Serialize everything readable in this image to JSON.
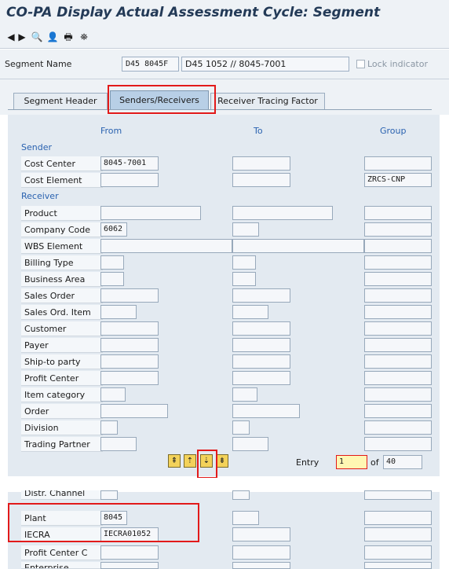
{
  "window": {
    "title": "CO-PA Display Actual Assessment Cycle: Segment"
  },
  "toolbar": {
    "back": "◀",
    "forward": "▶",
    "find": "🔍",
    "user": "👤",
    "print": "🖶",
    "tree": "⛯"
  },
  "segment": {
    "label": "Segment Name",
    "code": "D45 8045F",
    "description": "D45 1052 // 8045-7001",
    "lock_label": "Lock indicator"
  },
  "tabs": {
    "segment_header": "Segment Header",
    "senders_receivers": "Senders/Receivers",
    "receiver_tracing_factor": "Receiver Tracing Factor"
  },
  "columns": {
    "from": "From",
    "to": "To",
    "group": "Group"
  },
  "sections": {
    "sender": "Sender",
    "receiver": "Receiver"
  },
  "fields": {
    "cost_center": {
      "label": "Cost Center",
      "from": "8045-7001",
      "to": "",
      "group": ""
    },
    "cost_element": {
      "label": "Cost Element",
      "from": "",
      "to": "",
      "group": "ZRCS-CNP"
    },
    "product": {
      "label": "Product",
      "from": "",
      "to": "",
      "group": ""
    },
    "company_code": {
      "label": "Company Code",
      "from": "6062",
      "to": "",
      "group": ""
    },
    "wbs_element": {
      "label": "WBS Element",
      "from": "",
      "to": "",
      "group": ""
    },
    "billing_type": {
      "label": "Billing Type",
      "from": "",
      "to": "",
      "group": ""
    },
    "business_area": {
      "label": "Business Area",
      "from": "",
      "to": "",
      "group": ""
    },
    "sales_order": {
      "label": "Sales Order",
      "from": "",
      "to": "",
      "group": ""
    },
    "sales_ord_item": {
      "label": "Sales Ord. Item",
      "from": "",
      "to": "",
      "group": ""
    },
    "customer": {
      "label": "Customer",
      "from": "",
      "to": "",
      "group": ""
    },
    "payer": {
      "label": "Payer",
      "from": "",
      "to": "",
      "group": ""
    },
    "ship_to_party": {
      "label": "Ship-to party",
      "from": "",
      "to": "",
      "group": ""
    },
    "profit_center": {
      "label": "Profit Center",
      "from": "",
      "to": "",
      "group": ""
    },
    "item_category": {
      "label": "Item category",
      "from": "",
      "to": "",
      "group": ""
    },
    "order": {
      "label": "Order",
      "from": "",
      "to": "",
      "group": ""
    },
    "division": {
      "label": "Division",
      "from": "",
      "to": "",
      "group": ""
    },
    "trading_partner": {
      "label": "Trading Partner",
      "from": "",
      "to": "",
      "group": ""
    },
    "distr_channel": {
      "label": "Distr. Channel",
      "from": "",
      "to": "",
      "group": ""
    },
    "plant": {
      "label": "Plant",
      "from": "8045",
      "to": "",
      "group": ""
    },
    "iecra": {
      "label": "IECRA",
      "from": "IECRA01052",
      "to": "",
      "group": ""
    },
    "profit_center_c": {
      "label": "Profit Center C",
      "from": "",
      "to": "",
      "group": ""
    },
    "enterprise": {
      "label": "Enterprise",
      "from": "",
      "to": "",
      "group": ""
    }
  },
  "paging": {
    "first": "⇞",
    "prev": "⇡",
    "next": "⇣",
    "last": "⇟",
    "entry_label": "Entry",
    "entry_value": "1",
    "of_label": "of",
    "total": "40"
  }
}
